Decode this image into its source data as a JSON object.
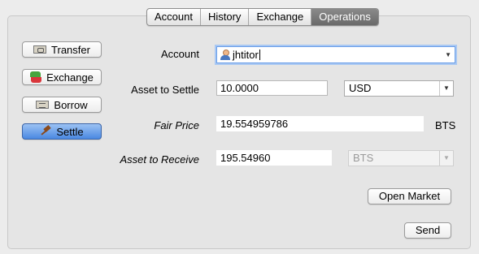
{
  "tabs": [
    {
      "label": "Account"
    },
    {
      "label": "History"
    },
    {
      "label": "Exchange"
    },
    {
      "label": "Operations"
    }
  ],
  "sidebar": {
    "transfer_label": "Transfer",
    "exchange_label": "Exchange",
    "borrow_label": "Borrow",
    "settle_label": "Settle"
  },
  "form": {
    "account_label": "Account",
    "account_value": "jhtitor",
    "asset_to_settle_label": "Asset to Settle",
    "asset_to_settle_amount": "10.0000",
    "asset_to_settle_symbol": "USD",
    "fair_price_label": "Fair Price",
    "fair_price_value": "19.554959786",
    "fair_price_unit": "BTS",
    "asset_to_receive_label": "Asset to Receive",
    "asset_to_receive_amount": "195.54960",
    "asset_to_receive_symbol": "BTS"
  },
  "actions": {
    "open_market_label": "Open Market",
    "send_label": "Send"
  },
  "colors": {
    "active_tab": "#767676",
    "selected_button": "#5a94e6",
    "focus_ring": "#a9c8f3"
  },
  "icons": {
    "transfer": "banknote-icon",
    "exchange": "exchange-icon",
    "borrow": "money-icon",
    "settle": "gavel-icon",
    "account": "user-icon"
  }
}
